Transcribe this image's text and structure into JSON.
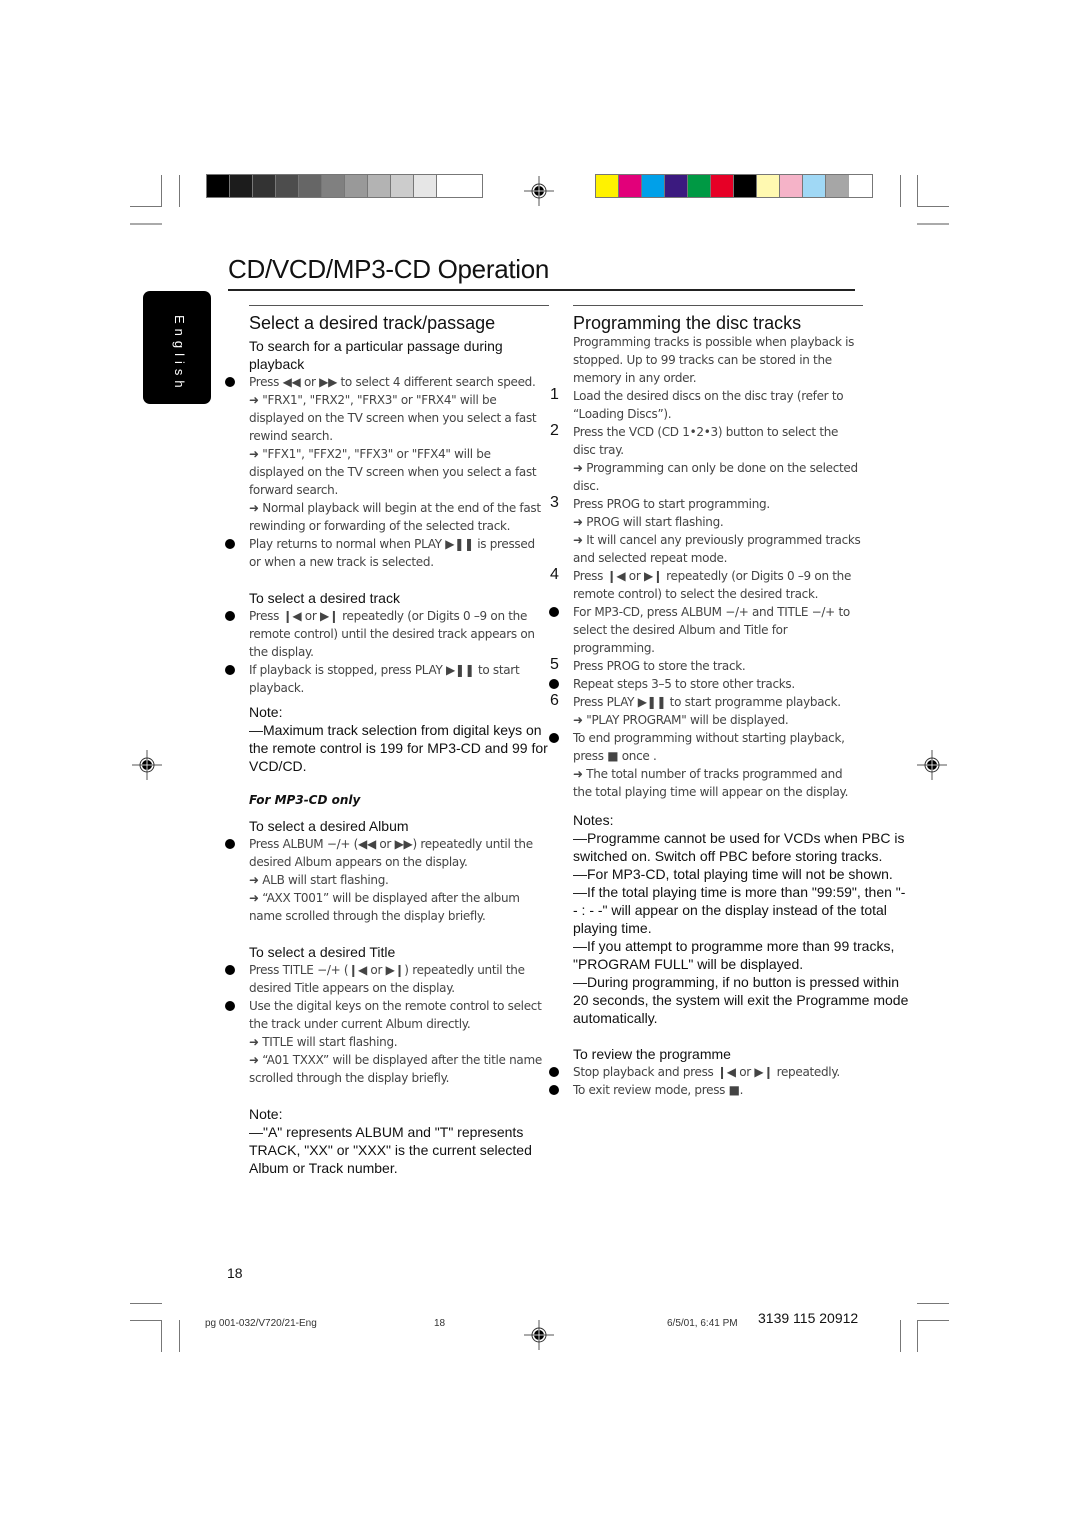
{
  "registration": {
    "grayscale_swatches": [
      "#000000",
      "#1c1c1c",
      "#333333",
      "#4d4d4d",
      "#666666",
      "#808080",
      "#999999",
      "#b3b3b3",
      "#cccccc",
      "#e6e6e6",
      "#ffffff"
    ],
    "color_swatches": [
      "#fff200",
      "#e2007a",
      "#00a0e9",
      "#3b1a7f",
      "#009944",
      "#e60026",
      "#000000",
      "#fff9b1",
      "#f5b3c8",
      "#a0d8f5",
      "#a6a6a6"
    ]
  },
  "page": {
    "title": "CD/VCD/MP3-CD Operation",
    "language_tab": "English",
    "page_number": "18"
  },
  "left": {
    "section_title": "Select a desired track/passage",
    "search_sub": "To search for a particular passage during playback",
    "search_items": [
      {
        "type": "bullet",
        "text": "Press ◀◀ or ▶▶ to select 4 different search speed."
      },
      {
        "type": "arrow",
        "text": "➜ \"FRX1\", \"FRX2\", \"FRX3\" or \"FRX4\" will be displayed on the TV screen when you select a fast rewind search."
      },
      {
        "type": "arrow",
        "text": "➜ \"FFX1\", \"FFX2\", \"FFX3\" or \"FFX4\" will be displayed on the TV screen when you select a fast forward search."
      },
      {
        "type": "arrow",
        "text": "➜ Normal playback will begin at the end of the fast rewinding or forwarding of the selected track."
      },
      {
        "type": "bullet",
        "text": "Play returns to normal when PLAY ▶❚❚ is pressed or when a new track is selected."
      }
    ],
    "track_sub": "To select a desired track",
    "track_items": [
      {
        "type": "bullet",
        "text": "Press ❙◀ or ▶❙ repeatedly (or Digits 0 –9 on the remote control) until the desired track appears on the display."
      },
      {
        "type": "bullet",
        "text": "If playback is stopped, press PLAY ▶❚❚ to start playback."
      }
    ],
    "note1_label": "Note:",
    "note1_text": "—Maximum track selection from digital keys on the remote control is 199 for MP3-CD and 99 for VCD/CD.",
    "mp3_heading": "For MP3-CD only",
    "album_sub": "To select a desired Album",
    "album_items": [
      {
        "type": "bullet",
        "text": "Press ALBUM −/+ (◀◀ or ▶▶) repeatedly until the desired Album appears on the display."
      },
      {
        "type": "arrow",
        "text": "➜ ALB will start flashing."
      },
      {
        "type": "arrow",
        "text": "➜ “AXX T001” will be displayed after the album name scrolled through the display briefly."
      }
    ],
    "title_sub": "To select a desired Title",
    "title_items": [
      {
        "type": "bullet",
        "text": "Press TITLE −/+ (❙◀ or ▶❙) repeatedly until the desired Title appears on the display."
      },
      {
        "type": "bullet",
        "text": "Use the digital keys on the remote control to select the track under current Album directly."
      },
      {
        "type": "arrow",
        "text": "➜ TITLE will start flashing."
      },
      {
        "type": "arrow",
        "text": "➜ “A01 TXXX” will be displayed after the title name scrolled through the display briefly."
      }
    ],
    "note2_label": "Note:",
    "note2_text": "—\"A\" represents ALBUM and \"T\" represents TRACK, \"XX\" or \"XXX\" is the current selected Album or Track number."
  },
  "right": {
    "section_title": "Programming the disc tracks",
    "intro": "Programming tracks is possible when playback is stopped. Up to 99 tracks can be stored in the memory in any order.",
    "steps": [
      {
        "marker": "1",
        "text": "Load the desired discs on the disc tray (refer to “Loading Discs”)."
      },
      {
        "marker": "2",
        "text": "Press the VCD (CD 1•2•3) button to select the disc tray."
      },
      {
        "marker": "",
        "text": "➜ Programming can only be done on the selected disc."
      },
      {
        "marker": "3",
        "text": "Press PROG to start programming."
      },
      {
        "marker": "",
        "text": "➜ PROG will start flashing."
      },
      {
        "marker": "",
        "text": "➜ It will cancel any previously programmed tracks and selected repeat mode."
      },
      {
        "marker": "4",
        "text": "Press ❙◀ or ▶❙ repeatedly (or Digits 0 –9 on the remote control) to select the desired track."
      },
      {
        "marker": "•",
        "text": "For MP3-CD, press ALBUM −/+ and TITLE −/+ to select the desired Album and Title for programming."
      },
      {
        "marker": "5",
        "text": "Press PROG to store the track."
      },
      {
        "marker": "•",
        "text": "Repeat steps 3–5 to store other tracks."
      },
      {
        "marker": "6",
        "text": "Press PLAY ▶❚❚ to start programme playback."
      },
      {
        "marker": "",
        "text": "➜ \"PLAY PROGRAM\" will be displayed."
      },
      {
        "marker": "•",
        "text": "To end programming without starting playback, press ■ once ."
      },
      {
        "marker": "",
        "text": "➜ The total number of tracks programmed and the total playing time will appear on the display."
      }
    ],
    "notes_label": "Notes:",
    "notes": [
      "—Programme cannot be used for VCDs when PBC is switched on. Switch off PBC before storing tracks.",
      "—For MP3-CD, total playing time will not be shown.",
      "—If the total playing time is more than \"99:59\", then \"- - : - -\" will appear on the display instead of the total playing time.",
      "—If you attempt to programme more than 99 tracks, \"PROGRAM FULL\" will be displayed.",
      "—During programming, if no button is pressed within 20 seconds, the system will exit the Programme mode automatically."
    ],
    "review_sub": "To review the programme",
    "review_items": [
      "Stop playback and press ❙◀ or ▶❙ repeatedly.",
      "To exit review mode, press ■."
    ]
  },
  "footer": {
    "file_label": "pg 001-032/V720/21-Eng",
    "page": "18",
    "timestamp": "6/5/01, 6:41 PM",
    "code": "3139 115 20912"
  }
}
